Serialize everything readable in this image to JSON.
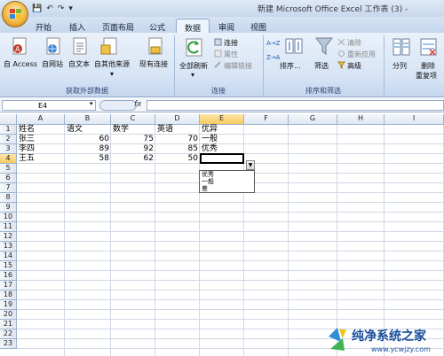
{
  "window": {
    "title": "新建 Microsoft Office Excel 工作表 (3) -"
  },
  "qat": {
    "save": "💾",
    "undo": "↶",
    "redo": "↷",
    "more": "▾"
  },
  "tabs": [
    "开始",
    "插入",
    "页面布局",
    "公式",
    "数据",
    "审阅",
    "视图"
  ],
  "active_tab": "数据",
  "ribbon": {
    "group_external": {
      "label": "获取外部数据",
      "buttons": [
        "自 Access",
        "自网站",
        "自文本",
        "自其他来源",
        "现有连接"
      ],
      "dropdown_mark": "▾"
    },
    "group_connections": {
      "label": "连接",
      "refresh_all": "全部刷新",
      "refresh_mark": "▾",
      "small": [
        "连接",
        "属性",
        "编辑链接"
      ]
    },
    "group_sort": {
      "label": "排序和筛选",
      "sort_asc": "A→Z",
      "sort_desc": "Z→A",
      "sort": "排序...",
      "filter": "筛选",
      "small": [
        "清除",
        "重新应用",
        "高级"
      ]
    },
    "group_tools": {
      "split": "分列",
      "remove_dup_line1": "删除",
      "remove_dup_line2": "重复项"
    }
  },
  "formula_bar": {
    "name_box": "E4",
    "fx": "fx",
    "value": ""
  },
  "sheet": {
    "columns": [
      "A",
      "B",
      "C",
      "D",
      "E",
      "F",
      "G",
      "H",
      "I"
    ],
    "rows": [
      "1",
      "2",
      "3",
      "4",
      "5",
      "6",
      "7",
      "8",
      "9",
      "10",
      "11",
      "12",
      "13",
      "14",
      "15",
      "16",
      "17",
      "18",
      "19",
      "20",
      "21",
      "22",
      "23"
    ],
    "cells": {
      "A1": "姓名",
      "B1": "语文",
      "C1": "数学",
      "D1": "英语",
      "E1": "优异",
      "A2": "张三",
      "B2": "60",
      "C2": "75",
      "D2": "70",
      "E2": "一般",
      "A3": "李四",
      "B3": "89",
      "C3": "92",
      "D3": "85",
      "E3": "优秀",
      "A4": "王五",
      "B4": "58",
      "C4": "62",
      "D4": "50",
      "E4": ""
    },
    "active_cell": "E4",
    "dropdown_options": [
      "优秀",
      "一般",
      "差"
    ],
    "dropdown_arrow": "▼"
  },
  "watermark": {
    "text": "纯净系统之家",
    "url": "www.ycwjzy.com"
  },
  "colors": {
    "accent": "#f5b845",
    "ribbon": "#d6e4f5",
    "grid": "#d0d7e5"
  }
}
